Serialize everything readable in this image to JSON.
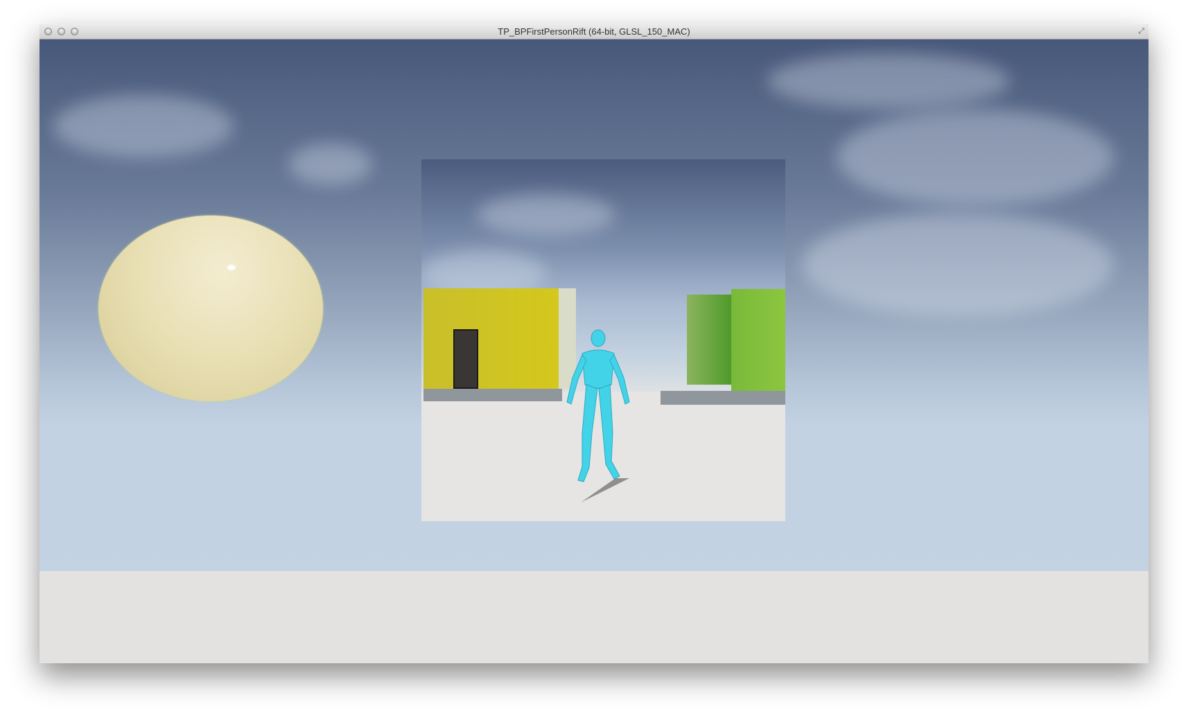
{
  "window": {
    "title": "TP_BPFirstPersonRift (64-bit, GLSL_150_MAC)",
    "buttons": [
      "close",
      "minimize",
      "zoom"
    ],
    "fullscreen_icon": "fullscreen-arrows-icon"
  },
  "colors": {
    "sky_top": "#48587a",
    "sky_horizon": "#c2d2e3",
    "floor": "#e3e2e1",
    "sphere": "#e9e0b6",
    "yellow_box": "#d4c81c",
    "green_box": "#8cc63f",
    "mannequin": "#3fd4e6"
  }
}
